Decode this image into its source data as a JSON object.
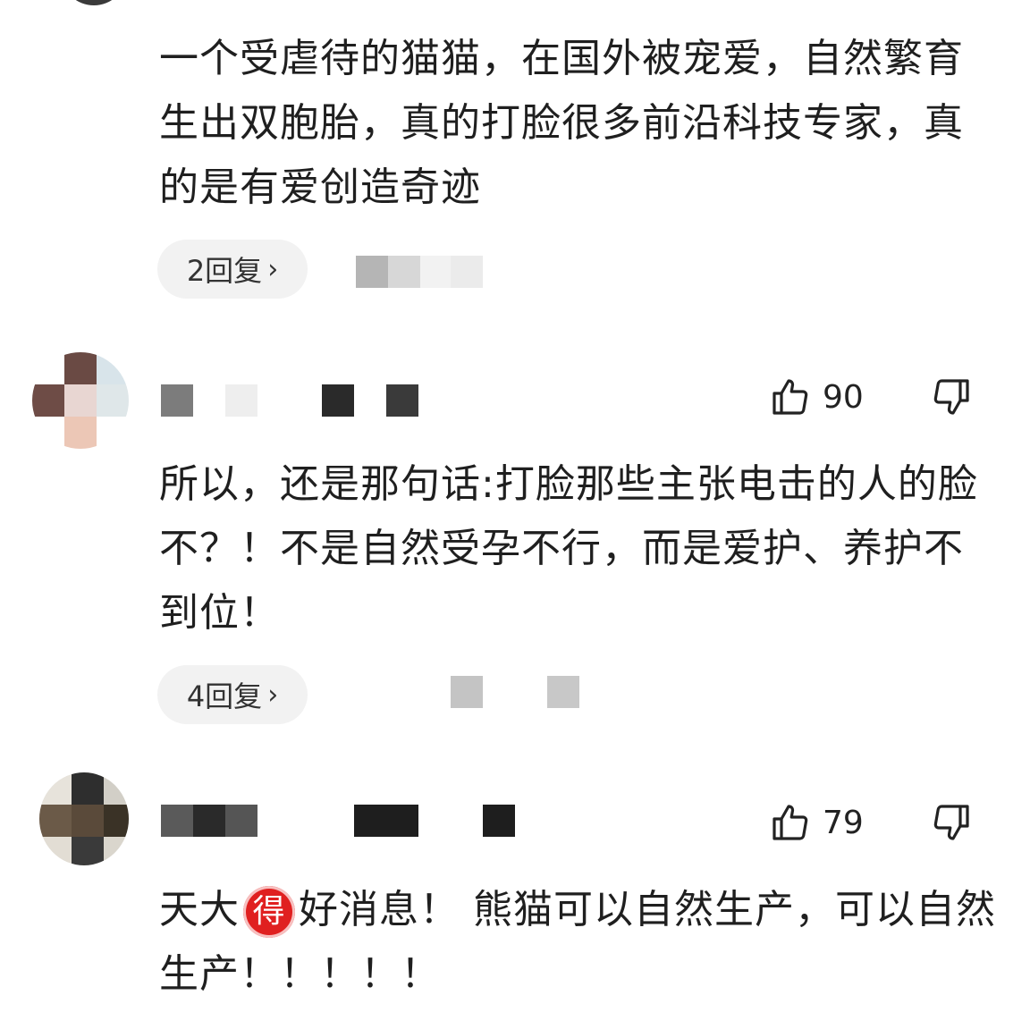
{
  "comments": [
    {
      "text": "一个受虐待的猫猫，在国外被宠爱，自然繁育生出双胞胎，真的打脸很多前沿科技专家，真的是有爱创造奇迹",
      "replies_label": "2回复"
    },
    {
      "likes": "90",
      "text": "所以，还是那句话:打脸那些主张电击的人的脸不？！不是自然受孕不行，而是爱护、养护不到位！",
      "replies_label": "4回复"
    },
    {
      "likes": "79",
      "text_before_badge": "天大",
      "badge": "得",
      "text_after_badge": "好消息！ 熊猫可以自然生产，可以自然生产！！！！！"
    }
  ],
  "icons": {
    "like": "thumbs-up-outline",
    "dislike": "thumbs-down-outline",
    "chevron": "chevron-right"
  },
  "colors": {
    "badge": "#e02020",
    "pill": "#f2f2f2"
  }
}
